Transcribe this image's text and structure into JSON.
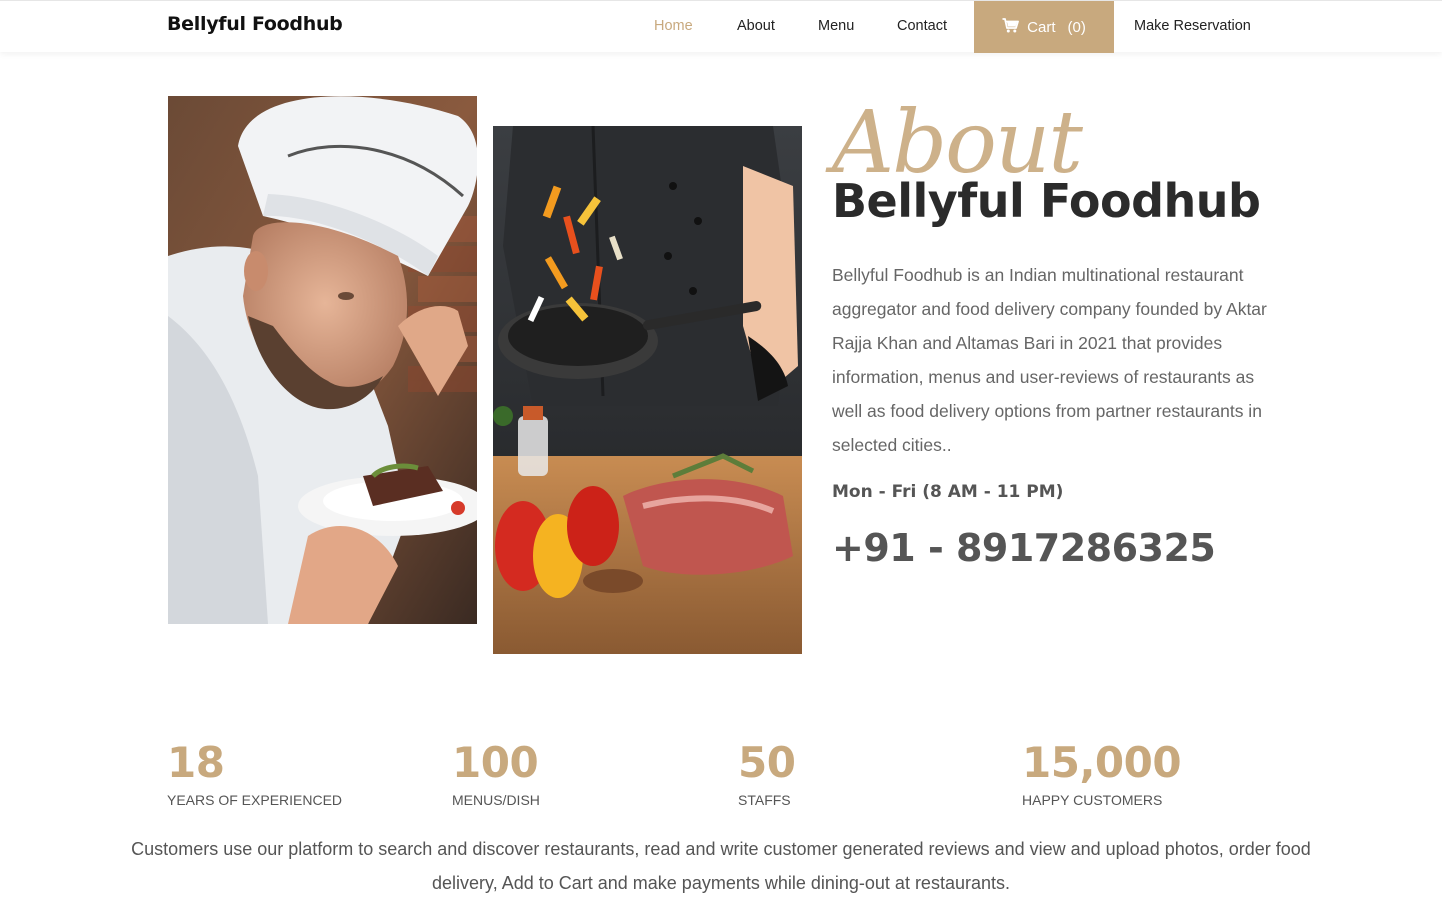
{
  "navbar": {
    "brand": "Bellyful Foodhub",
    "links": {
      "home": "Home",
      "about": "About",
      "menu": "Menu",
      "contact": "Contact",
      "reservation": "Make Reservation"
    },
    "cart": {
      "label": "Cart",
      "count": "(0)",
      "icon": "cart-icon"
    },
    "active": "home"
  },
  "about": {
    "script_heading": "About",
    "title": "Bellyful Foodhub",
    "description": "Bellyful Foodhub is an Indian multinational restaurant aggregator and food delivery company founded by Aktar Rajja Khan and Altamas Bari in 2021 that provides information, menus and user-reviews of restaurants as well as food delivery options from partner restaurants in selected cities..",
    "hours": "Mon - Fri (8 AM - 11 PM)",
    "phone": "+91 - 8917286325"
  },
  "stats": [
    {
      "value": "18",
      "label": "Years of Experienced"
    },
    {
      "value": "100",
      "label": "Menus/Dish"
    },
    {
      "value": "50",
      "label": "Staffs"
    },
    {
      "value": "15,000",
      "label": "Happy Customers"
    }
  ],
  "footer_text": "Customers use our platform to search and discover restaurants, read and write customer generated reviews and view and upload photos, order food delivery, Add to Cart and make payments while dining-out at restaurants.",
  "colors": {
    "accent": "#c8a97e",
    "heading": "#2b2b2b",
    "body_text": "#666666"
  }
}
